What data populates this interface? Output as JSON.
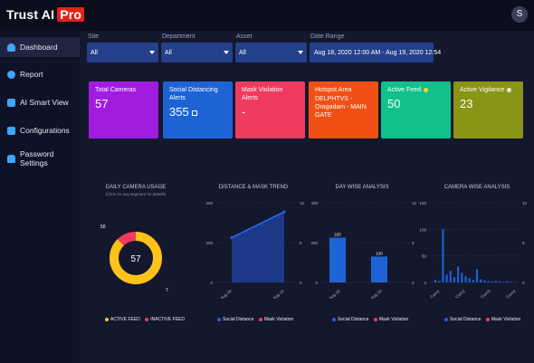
{
  "app": {
    "brand": "Trust AI",
    "brand_badge": "Pro",
    "user_initial": "S"
  },
  "sidebar": {
    "items": [
      {
        "label": "Dashboard",
        "icon": "user-icon",
        "active": true
      },
      {
        "label": "Report",
        "icon": "gear-icon",
        "active": false
      },
      {
        "label": "AI Smart View",
        "icon": "monitor-icon",
        "active": false
      },
      {
        "label": "Configurations",
        "icon": "grid-icon",
        "active": false
      },
      {
        "label": "Password Settings",
        "icon": "lock-icon",
        "active": false
      }
    ]
  },
  "filters": {
    "site": {
      "label": "Site",
      "value": "All"
    },
    "department": {
      "label": "Department",
      "value": "All"
    },
    "asset": {
      "label": "Asset",
      "value": "All"
    },
    "date_range": {
      "label": "Date Range",
      "value": "Aug 18, 2020 12:00 AM - Aug 19, 2020 12:54"
    }
  },
  "cards": [
    {
      "title": "Total Cameras",
      "value": "57",
      "color": "#a21ce0"
    },
    {
      "title": "Social Distancing Alerts",
      "value": "355",
      "color": "#1d63d6"
    },
    {
      "title": "Mask Violation Alerts",
      "value": "-",
      "color": "#f03a5f"
    },
    {
      "title": "Hotspot Area",
      "value": "DELPHTVS - Oragadam - MAIN GATE",
      "color": "#f05014"
    },
    {
      "title": "Active Feed",
      "value": "50",
      "color": "#11c08a"
    },
    {
      "title": "Active Vigilance",
      "value": "23",
      "color": "#8a9416"
    }
  ],
  "charts": {
    "daily": {
      "title": "DAILY CAMERA USAGE",
      "subtitle": "(Click on any segment for details)",
      "center": "57",
      "active_label": "50",
      "inactive_label": "7",
      "legend_active": "ACTIVE FEED",
      "legend_inactive": "INACTIVE FEED"
    },
    "trend": {
      "title": "DISTANCE & MASK TREND",
      "y_left": [
        "400",
        "200",
        "0"
      ],
      "y_right": [
        "10",
        "5",
        "0"
      ],
      "x": [
        "Aug 18",
        "Aug 19"
      ],
      "legend_a": "Social Distance",
      "legend_b": "Mask Violation"
    },
    "day": {
      "title": "DAY WISE ANALYSIS",
      "y_left": [
        "400",
        "200",
        "0"
      ],
      "y_right": [
        "10",
        "5",
        "0"
      ],
      "x": [
        "Aug 18",
        "Aug 19"
      ],
      "bar_labels": [
        "225",
        "130"
      ],
      "legend_a": "Social Distance",
      "legend_b": "Mask Violation"
    },
    "camera": {
      "title": "CAMERA WISE ANALYSIS",
      "y_left": [
        "150",
        "100",
        "50",
        "0"
      ],
      "y_right": [
        "10",
        "5",
        "0"
      ],
      "x": [
        "Cam1",
        "Cam2",
        "Cam3",
        "Cam4"
      ],
      "legend_a": "Social Distance",
      "legend_b": "Mask Violation"
    }
  },
  "colors": {
    "social": "#1d63d6",
    "mask": "#f03a5f",
    "active": "#ffc21a",
    "inactive": "#f03a5f"
  },
  "chart_data": [
    {
      "type": "pie",
      "title": "DAILY CAMERA USAGE",
      "categories": [
        "ACTIVE FEED",
        "INACTIVE FEED"
      ],
      "values": [
        50,
        7
      ]
    },
    {
      "type": "area",
      "title": "DISTANCE & MASK TREND",
      "categories": [
        "Aug 18",
        "Aug 19"
      ],
      "series": [
        {
          "name": "Social Distance",
          "values": [
            225,
            355
          ]
        },
        {
          "name": "Mask Violation",
          "values": [
            0,
            0
          ]
        }
      ],
      "ylim": [
        0,
        400
      ]
    },
    {
      "type": "bar",
      "title": "DAY WISE ANALYSIS",
      "categories": [
        "Aug 18",
        "Aug 19"
      ],
      "series": [
        {
          "name": "Social Distance",
          "values": [
            225,
            130
          ]
        },
        {
          "name": "Mask Violation",
          "values": [
            0,
            0
          ]
        }
      ],
      "ylim": [
        0,
        400
      ]
    },
    {
      "type": "bar",
      "title": "CAMERA WISE ANALYSIS",
      "series": [
        {
          "name": "Social Distance",
          "values": [
            5,
            3,
            100,
            15,
            22,
            10,
            30,
            18,
            12,
            8,
            5,
            25,
            6,
            4,
            3,
            2,
            3,
            2,
            1,
            2,
            1,
            1
          ]
        },
        {
          "name": "Mask Violation",
          "values": []
        }
      ],
      "ylim": [
        0,
        150
      ]
    }
  ]
}
